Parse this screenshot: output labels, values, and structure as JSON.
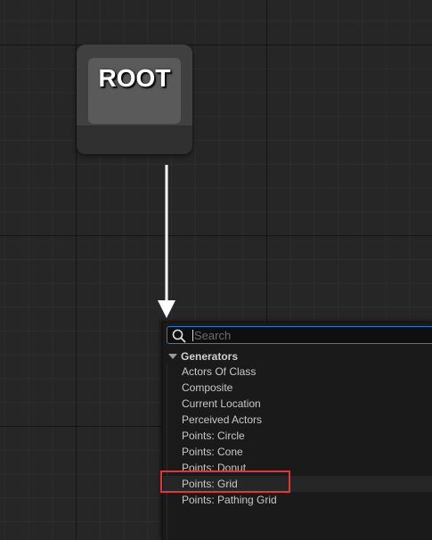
{
  "root_node": {
    "label": "ROOT"
  },
  "context_menu": {
    "search": {
      "placeholder": "Search",
      "value": ""
    },
    "category": {
      "label": "Generators",
      "items": [
        {
          "label": "Actors Of Class"
        },
        {
          "label": "Composite"
        },
        {
          "label": "Current Location"
        },
        {
          "label": "Perceived Actors"
        },
        {
          "label": "Points: Circle"
        },
        {
          "label": "Points: Cone"
        },
        {
          "label": "Points: Donut"
        },
        {
          "label": "Points: Grid"
        },
        {
          "label": "Points: Pathing Grid"
        }
      ]
    }
  },
  "colors": {
    "background": "#262626",
    "menu_background": "#1a1a1a",
    "search_border": "#2c7bd0",
    "highlight_annotation": "#e0353b",
    "arrow": "#ffffff"
  }
}
